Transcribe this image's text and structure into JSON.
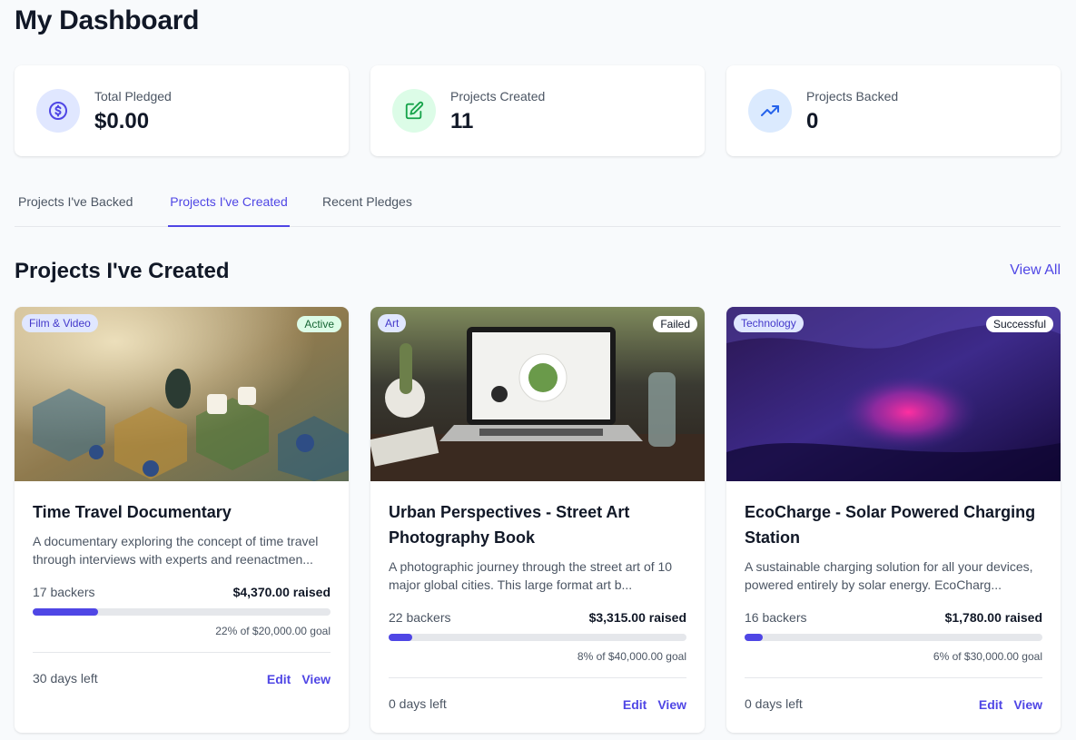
{
  "page": {
    "title": "My Dashboard"
  },
  "stats": [
    {
      "label": "Total Pledged",
      "value": "$0.00",
      "icon": "dollar-circle-icon",
      "color": "#4f46e5",
      "bg": "#e0e7ff"
    },
    {
      "label": "Projects Created",
      "value": "11",
      "icon": "edit-icon",
      "color": "#16a34a",
      "bg": "#dcfce7"
    },
    {
      "label": "Projects Backed",
      "value": "0",
      "icon": "trending-up-icon",
      "color": "#2563eb",
      "bg": "#dbeafe"
    }
  ],
  "tabs": [
    {
      "label": "Projects I've Backed",
      "active": false
    },
    {
      "label": "Projects I've Created",
      "active": true
    },
    {
      "label": "Recent Pledges",
      "active": false
    }
  ],
  "section": {
    "title": "Projects I've Created",
    "view_all": "View All"
  },
  "projects": [
    {
      "category": "Film & Video",
      "status": "Active",
      "name": "Time Travel Documentary",
      "description": "A documentary exploring the concept of time travel through interviews with experts and reenactmen...",
      "backers": "17 backers",
      "raised": "$4,370.00 raised",
      "progress": 0.22,
      "goal_text": "22% of $20,000.00 goal",
      "days_left": "30 days left",
      "edit": "Edit",
      "view": "View"
    },
    {
      "category": "Art",
      "status": "Failed",
      "name": "Urban Perspectives - Street Art Photography Book",
      "description": "A photographic journey through the street art of 10 major global cities. This large format art b...",
      "backers": "22 backers",
      "raised": "$3,315.00 raised",
      "progress": 0.08,
      "goal_text": "8% of $40,000.00 goal",
      "days_left": "0 days left",
      "edit": "Edit",
      "view": "View"
    },
    {
      "category": "Technology",
      "status": "Successful",
      "name": "EcoCharge - Solar Powered Charging Station",
      "description": "A sustainable charging solution for all your devices, powered entirely by solar energy. EcoCharg...",
      "backers": "16 backers",
      "raised": "$1,780.00 raised",
      "progress": 0.06,
      "goal_text": "6% of $30,000.00 goal",
      "days_left": "0 days left",
      "edit": "Edit",
      "view": "View"
    }
  ],
  "colors": {
    "accent": "#4f46e5",
    "status_active_bg": "#dcfce7",
    "status_active_fg": "#166534",
    "status_neutral_bg": "#ffffff",
    "status_neutral_fg": "#111827"
  }
}
